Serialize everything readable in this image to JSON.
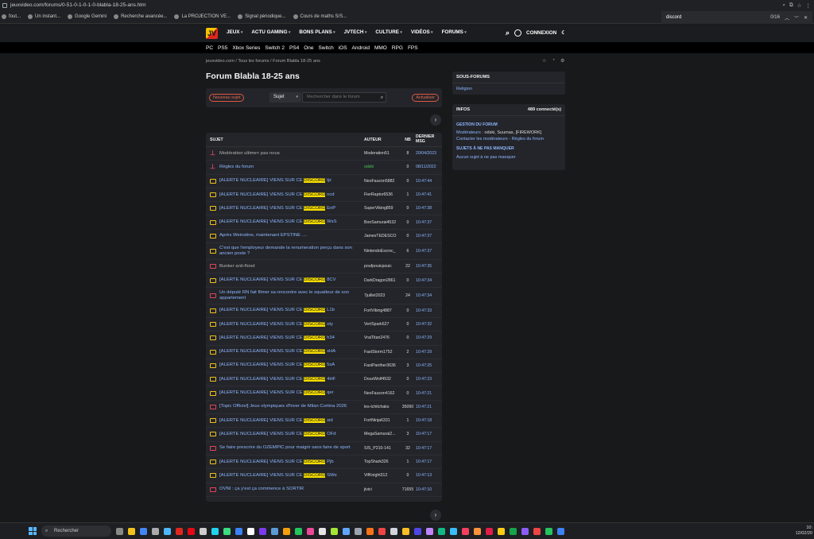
{
  "browser": {
    "url": "jeuxvideo.com/forums/0-51-0-1-0-1-0-blabla-18-25-ans.htm",
    "bookmarks": [
      "fout...",
      "Un instant...",
      "Google Gemini",
      "Recherche avancée...",
      "La PROJECTION VE...",
      "Signal périodique...",
      "Cours de maths S/S..."
    ],
    "find": {
      "term": "discord",
      "count": "0/16"
    },
    "side_tab": "Tous les"
  },
  "nav": {
    "logo": "JV",
    "menu": [
      "JEUX",
      "ACTU GAMING",
      "BONS PLANS",
      "JVTECH",
      "CULTURE",
      "VIDÉOS",
      "FORUMS"
    ],
    "connexion": "CONNEXION",
    "platforms": [
      "PC",
      "PS5",
      "Xbox Series",
      "Switch 2",
      "PS4",
      "One",
      "Switch",
      "iOS",
      "Android",
      "MMO",
      "RPG",
      "FPS"
    ]
  },
  "breadcrumb": "jeuxvideo.com / Tous les forums / Forum Blabla 18-25 ans",
  "page_title": "Forum Blabla 18-25 ans",
  "toolbar": {
    "new_topic": "Nouveau sujet",
    "select": "Sujet",
    "search_placeholder": "Rechercher dans le forum",
    "refresh": "Actualiser"
  },
  "table": {
    "headers": {
      "subject": "SUJET",
      "author": "AUTEUR",
      "nb": "NB",
      "last": "DERNIER MSG"
    },
    "rows": [
      {
        "pre": "Modération ultime< pas nous",
        "hl": "",
        "post": "",
        "author": "Moderation51",
        "nb": "8",
        "last": "20/04/2023",
        "icon": "pin",
        "subjColor": "#b5b5b5"
      },
      {
        "pre": "Règles du forum",
        "hl": "",
        "post": "",
        "author": "odski",
        "nb": "0",
        "last": "08/11/2022",
        "icon": "pin",
        "authorColor": "#4bc45b"
      },
      {
        "pre": "[ALERTE NUCLEAIRE] VIENS SUR CE ",
        "hl": "DISCORD",
        "post": " tjz",
        "author": "NeoFaucon5882",
        "nb": "0",
        "last": "10:47:44",
        "icon": "folder"
      },
      {
        "pre": "[ALERTE NUCLEAIRE] VIENS SUR CE ",
        "hl": "DISCORD",
        "post": " ncd",
        "author": "FierRaptor6536",
        "nb": "1",
        "last": "10:47:41",
        "icon": "folder"
      },
      {
        "pre": "[ALERTE NUCLEAIRE] VIENS SUR CE ",
        "hl": "DISCORD",
        "post": " EnP",
        "author": "SuperViking859",
        "nb": "0",
        "last": "10:47:38",
        "icon": "folder"
      },
      {
        "pre": "[ALERTE NUCLEAIRE] VIENS SUR CE ",
        "hl": "DISCORD",
        "post": " WsS",
        "author": "BonSamurai4532",
        "nb": "0",
        "last": "10:47:37",
        "icon": "folder"
      },
      {
        "pre": "Après Weinstine, maintenant EPSTINE ....",
        "hl": "",
        "post": "",
        "author": "JamesTEDESCO",
        "nb": "0",
        "last": "10:47:37",
        "icon": "folder"
      },
      {
        "pre": "C'est que l'employeur demande la renumeration perçu dans son ancien poste ?",
        "hl": "",
        "post": "",
        "author": "NintendoEscroc_",
        "nb": "6",
        "last": "10:47:37",
        "icon": "folder",
        "tall": true
      },
      {
        "pre": "Bunker anti-flood",
        "hl": "",
        "post": "",
        "author": "poufpouicpouic",
        "nb": "22",
        "last": "10:47:35",
        "icon": "red",
        "subjColor": "#b5b5b5"
      },
      {
        "pre": "[ALERTE NUCLEAIRE] VIENS SUR CE ",
        "hl": "DISCORD",
        "post": " 8CV",
        "author": "DarkDragon2861",
        "nb": "0",
        "last": "10:47:34",
        "icon": "folder"
      },
      {
        "pre": "Un député RN fait filmer sa rencontre avec le squatteur de son appartement",
        "hl": "",
        "post": "",
        "author": "7juillet2023",
        "nb": "24",
        "last": "10:47:34",
        "icon": "red",
        "tall": true
      },
      {
        "pre": "[ALERTE NUCLEAIRE] VIENS SUR CE ",
        "hl": "DISCORD",
        "post": " L1b",
        "author": "FortViking4887",
        "nb": "0",
        "last": "10:47:33",
        "icon": "folder"
      },
      {
        "pre": "[ALERTE NUCLEAIRE] VIENS SUR CE ",
        "hl": "DISCORD",
        "post": " oty",
        "author": "VertSpark627",
        "nb": "0",
        "last": "10:47:32",
        "icon": "folder"
      },
      {
        "pre": "[ALERTE NUCLEAIRE] VIENS SUR CE ",
        "hl": "DISCORD",
        "post": " h34",
        "author": "VraiTitan2476",
        "nb": "0",
        "last": "10:47:29",
        "icon": "folder"
      },
      {
        "pre": "[ALERTE NUCLEAIRE] VIENS SUR CE ",
        "hl": "DISCORD",
        "post": " xHA",
        "author": "FastStorm1752",
        "nb": "2",
        "last": "10:47:29",
        "icon": "folder"
      },
      {
        "pre": "[ALERTE NUCLEAIRE] VIENS SUR CE ",
        "hl": "DISCORD",
        "post": " 5sA",
        "author": "FastPanther3636",
        "nb": "3",
        "last": "10:47:25",
        "icon": "folder"
      },
      {
        "pre": "[ALERTE NUCLEAIRE] VIENS SUR CE ",
        "hl": "DISCORD",
        "post": " 4HF",
        "author": "DouxWolf4532",
        "nb": "0",
        "last": "10:47:23",
        "icon": "folder"
      },
      {
        "pre": "[ALERTE NUCLEAIRE] VIENS SUR CE ",
        "hl": "DISCORD",
        "post": " qer",
        "author": "NeoFaucon4162",
        "nb": "0",
        "last": "10:47:21",
        "icon": "folder"
      },
      {
        "pre": "[Topic Officiel] Jeux olympiques d'hiver de Milan Cortina 2026",
        "hl": "",
        "post": "",
        "author": "les-tchitchaks",
        "nb": "35090",
        "last": "10:47:21",
        "icon": "red"
      },
      {
        "pre": "[ALERTE NUCLEAIRE] VIENS SUR CE ",
        "hl": "DISCORD",
        "post": " sid",
        "author": "FortNinja6331",
        "nb": "1",
        "last": "10:47:18",
        "icon": "folder"
      },
      {
        "pre": "[ALERTE NUCLEAIRE] VIENS SUR CE ",
        "hl": "DISCORD",
        "post": " OFd",
        "author": "MegaSamurai2...",
        "nb": "3",
        "last": "10:47:17",
        "icon": "folder"
      },
      {
        "pre": "Se faire prescrire du OZEMPIC pour maigrir sans faire de sport",
        "hl": "",
        "post": "",
        "author": "SIS_P210-141",
        "nb": "32",
        "last": "10:47:17",
        "icon": "red"
      },
      {
        "pre": "[ALERTE NUCLEAIRE] VIENS SUR CE ",
        "hl": "DISCORD",
        "post": " Pjb",
        "author": "TopShark326",
        "nb": "1",
        "last": "10:47:17",
        "icon": "folder"
      },
      {
        "pre": "[ALERTE NUCLEAIRE] VIENS SUR CE ",
        "hl": "DISCORD",
        "post": " SWe",
        "author": "VifKnight312",
        "nb": "0",
        "last": "10:47:13",
        "icon": "folder"
      },
      {
        "pre": "OVNI : ça y'est ça commence à SORTIR",
        "hl": "",
        "post": "",
        "author": "jivici",
        "nb": "71655",
        "last": "10:47:10",
        "icon": "red"
      }
    ]
  },
  "sidebar": {
    "subforums": {
      "title": "SOUS-FORUMS",
      "items": [
        "Religion"
      ]
    },
    "infos": {
      "title": "INFOS",
      "connected": "489 connecté(s)",
      "gestion_title": "GESTION DU FORUM",
      "moderators_label": "Modérateurs :",
      "moderators": "odski, Suumas, [FIREWORK]",
      "links": "Contacter les modérateurs - Règles du forum",
      "must_title": "SUJETS À NE PAS MANQUER",
      "must_text": "Aucun sujet à ne pas manquer"
    }
  },
  "taskbar": {
    "search": "Rechercher",
    "time": "10:",
    "date": "12/02/20"
  }
}
